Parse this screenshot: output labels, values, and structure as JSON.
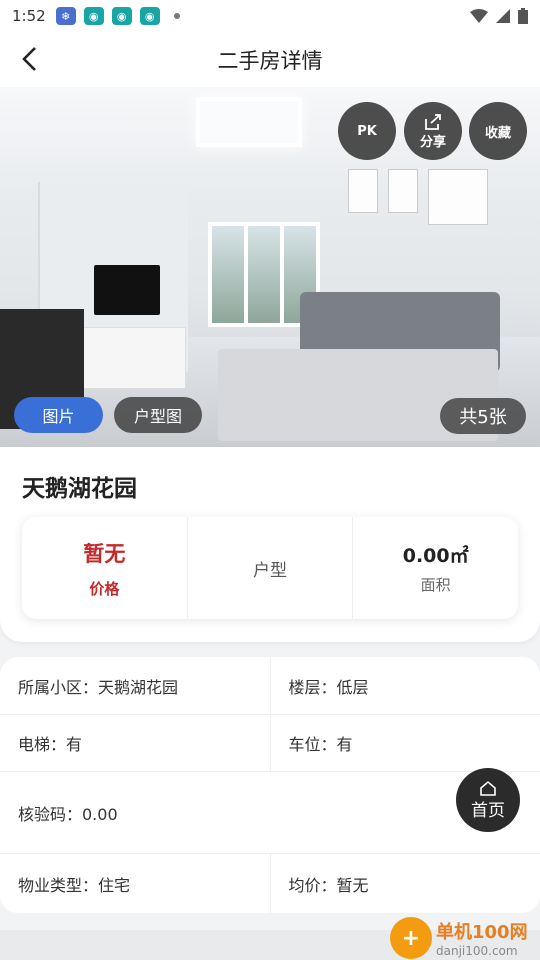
{
  "status_bar": {
    "time": "1:52"
  },
  "header": {
    "title": "二手房详情"
  },
  "gallery": {
    "pk_label": "PK",
    "share_label": "分享",
    "favorite_label": "收藏",
    "tab_photos": "图片",
    "tab_floorplan": "户型图",
    "count_label": "共5张"
  },
  "property": {
    "name": "天鹅湖花园",
    "price_value": "暂无",
    "price_label": "价格",
    "layout_label": "户型",
    "area_value": "0.00㎡",
    "area_label": "面积"
  },
  "details": {
    "community": "所属小区：天鹅湖花园",
    "floor": "楼层：低层",
    "elevator": "电梯：有",
    "parking": "车位：有",
    "verify_code": "核验码：0.00",
    "property_type": "物业类型：住宅",
    "avg_price": "均价：暂无"
  },
  "home_button": {
    "label": "首页"
  },
  "watermark": {
    "line1": "单机100网",
    "line2": "danji100.com"
  },
  "colors": {
    "accent_blue": "#3a6fd8",
    "price_red": "#c5292a"
  }
}
